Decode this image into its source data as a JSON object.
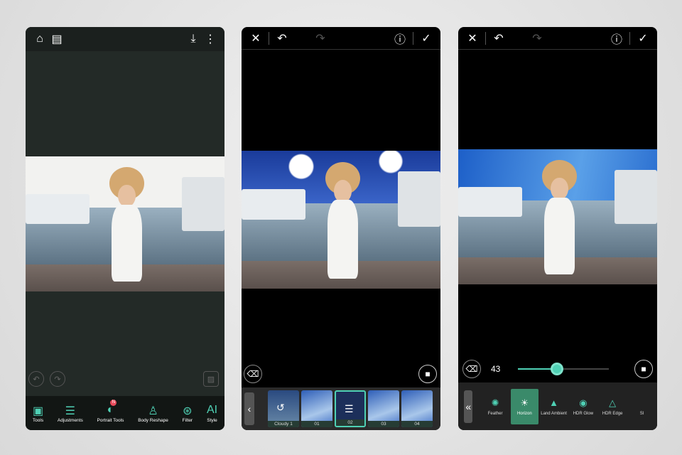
{
  "screen1": {
    "tools": [
      {
        "label": "Tools",
        "icon": "image-gear-icon",
        "glyph": "▣"
      },
      {
        "label": "Adjustments",
        "icon": "sliders-icon",
        "glyph": "☰"
      },
      {
        "label": "Portrait Tools",
        "icon": "portrait-icon",
        "glyph": "◐",
        "badge": "N"
      },
      {
        "label": "Body Reshape",
        "icon": "body-icon",
        "glyph": "♙"
      },
      {
        "label": "Filter",
        "icon": "filter-icon",
        "glyph": "⊛"
      },
      {
        "label": "Style",
        "icon": "ai-style-icon",
        "glyph": "AI"
      }
    ]
  },
  "screen2": {
    "thumbnails": [
      {
        "label": "Cloudy 1"
      },
      {
        "label": "01"
      },
      {
        "label": "02"
      },
      {
        "label": "03"
      },
      {
        "label": "04"
      }
    ]
  },
  "screen3": {
    "slider_value": "43",
    "slider_fraction": 0.43,
    "effects": [
      {
        "label": "Feather",
        "glyph": "✺"
      },
      {
        "label": "Horizon",
        "glyph": "☀"
      },
      {
        "label": "Land Ambient",
        "glyph": "▲"
      },
      {
        "label": "HDR Glow",
        "glyph": "◉"
      },
      {
        "label": "HDR Edge",
        "glyph": "△"
      },
      {
        "label": "Sl",
        "glyph": ""
      }
    ]
  },
  "colors": {
    "accent": "#4fd1b5",
    "selected": "#3a8a6a"
  }
}
